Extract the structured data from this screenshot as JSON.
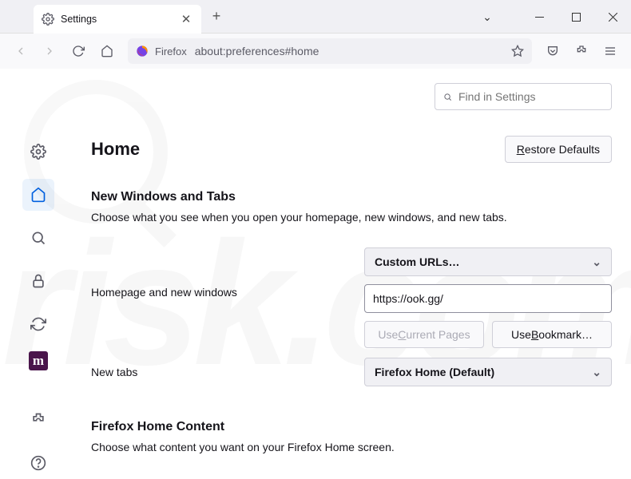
{
  "tab": {
    "title": "Settings"
  },
  "urlbar": {
    "identity": "Firefox",
    "url": "about:preferences#home"
  },
  "search": {
    "placeholder": "Find in Settings"
  },
  "page": {
    "title": "Home",
    "restore_defaults": "Restore Defaults"
  },
  "section1": {
    "heading": "New Windows and Tabs",
    "desc": "Choose what you see when you open your homepage, new windows, and new tabs."
  },
  "homepage": {
    "label": "Homepage and new windows",
    "mode": "Custom URLs…",
    "url_value": "https://ook.gg/",
    "use_current": "Use Current Pages",
    "use_bookmark": "Use Bookmark…"
  },
  "newtabs": {
    "label": "New tabs",
    "mode": "Firefox Home (Default)"
  },
  "section2": {
    "heading": "Firefox Home Content",
    "desc": "Choose what content you want on your Firefox Home screen."
  }
}
